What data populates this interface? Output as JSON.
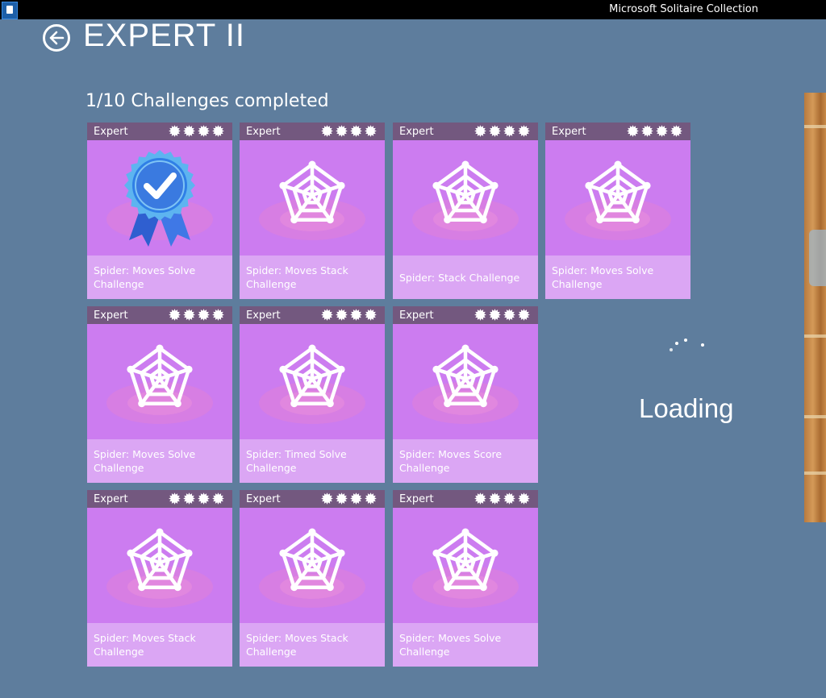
{
  "window": {
    "title": "Microsoft Solitaire Collection"
  },
  "header": {
    "title": "EXPERT II",
    "back_icon": "back-arrow-icon"
  },
  "progress": {
    "text": "1/10 Challenges completed",
    "completed": 1,
    "total": 10
  },
  "tiles": [
    {
      "level": "Expert",
      "stars": 4,
      "caption": "Spider: Moves Solve Challenge",
      "icon": "completed-ribbon-icon"
    },
    {
      "level": "Expert",
      "stars": 4,
      "caption": "Spider: Moves Stack Challenge",
      "icon": "spider-web-icon"
    },
    {
      "level": "Expert",
      "stars": 4,
      "caption": "Spider: Stack Challenge",
      "icon": "spider-web-icon"
    },
    {
      "level": "Expert",
      "stars": 4,
      "caption": "Spider: Moves Solve Challenge",
      "icon": "spider-web-icon"
    },
    {
      "level": "Expert",
      "stars": 4,
      "caption": "Spider: Moves Solve Challenge",
      "icon": "spider-web-icon"
    },
    {
      "level": "Expert",
      "stars": 4,
      "caption": "Spider: Timed Solve Challenge",
      "icon": "spider-web-icon"
    },
    {
      "level": "Expert",
      "stars": 4,
      "caption": "Spider: Moves Score Challenge",
      "icon": "spider-web-icon"
    },
    {
      "level": "Expert",
      "stars": 4,
      "caption": "Spider: Moves Stack Challenge",
      "icon": "spider-web-icon"
    },
    {
      "level": "Expert",
      "stars": 4,
      "caption": "Spider: Moves Stack Challenge",
      "icon": "spider-web-icon"
    },
    {
      "level": "Expert",
      "stars": 4,
      "caption": "Spider: Moves Solve Challenge",
      "icon": "spider-web-icon"
    }
  ],
  "loading": {
    "text": "Loading",
    "icon": "loading-spinner-icon"
  },
  "colors": {
    "background": "#5e7d9d",
    "tile_header": "#73587f",
    "tile_body": "#cc7cf0",
    "tile_caption": "#dba6f4",
    "ribbon": "#2f7fe6"
  }
}
